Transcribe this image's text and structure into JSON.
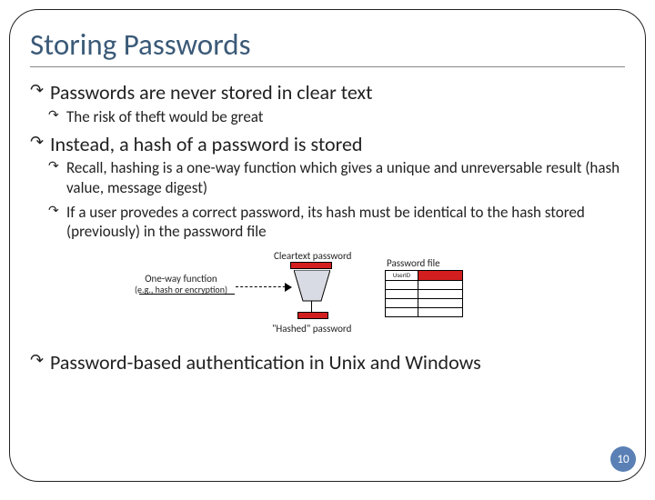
{
  "title": "Storing Passwords",
  "bullets": {
    "b1": "Passwords are never stored in clear text",
    "b1a": "The risk of theft would be great",
    "b2": "Instead, a hash of a password is stored",
    "b2a": "Recall, hashing is a one-way function which gives a unique and unreversable result (hash value, message digest)",
    "b2b": "If a user provedes a correct password, its hash must be identical to the hash stored (previously) in the password file",
    "b3": "Password-based authentication in Unix and Windows"
  },
  "diagram": {
    "cleartext": "Cleartext password",
    "oneway": "One-way function",
    "oneway_sub": "(e.g., hash or encryption)",
    "hashed": "\"Hashed\" password",
    "pwfile": "Password file",
    "userid": "UserID"
  },
  "page": "10"
}
